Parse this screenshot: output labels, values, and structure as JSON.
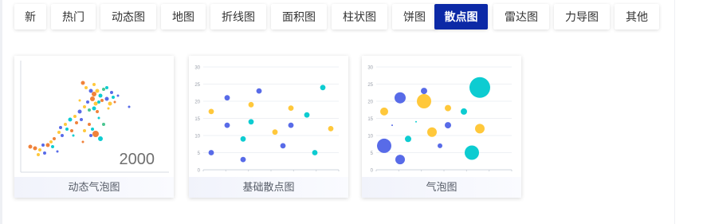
{
  "tabs": [
    {
      "label": "新",
      "active": false
    },
    {
      "label": "热门",
      "active": false
    },
    {
      "label": "动态图",
      "active": false
    },
    {
      "label": "地图",
      "active": false
    },
    {
      "label": "折线图",
      "active": false
    },
    {
      "label": "面积图",
      "active": false
    },
    {
      "label": "柱状图",
      "active": false
    },
    {
      "label": "饼图",
      "active": false
    },
    {
      "label": "散点图",
      "active": true
    },
    {
      "label": "雷达图",
      "active": false
    },
    {
      "label": "力导图",
      "active": false
    },
    {
      "label": "其他",
      "active": false
    }
  ],
  "cards": [
    {
      "caption": "动态气泡图",
      "year_label": "2000"
    },
    {
      "caption": "基础散点图"
    },
    {
      "caption": "气泡图"
    }
  ],
  "colors": {
    "active_tab": "#0c29a6",
    "blue": "#4f63e7",
    "yellow": "#ffc530",
    "cyan": "#00c9cf",
    "orange": "#ef7b2f",
    "green": "#3fc28a"
  },
  "chart_data": [
    {
      "type": "scatter",
      "title": "",
      "note": "dense animated bubble scatter thumbnail",
      "year_label": "2000"
    },
    {
      "type": "scatter",
      "title": "",
      "ylim": [
        0,
        30
      ],
      "ytick_labels": [
        "0",
        "5",
        "10",
        "15",
        "20",
        "25",
        "30"
      ],
      "series": [
        {
          "color": "#ffc530",
          "points": [
            [
              1,
              17
            ],
            [
              6,
              19
            ],
            [
              9,
              11
            ],
            [
              11,
              18
            ],
            [
              16,
              12
            ]
          ]
        },
        {
          "color": "#4f63e7",
          "points": [
            [
              1,
              5
            ],
            [
              3,
              21
            ],
            [
              3,
              13
            ],
            [
              5,
              3
            ],
            [
              7,
              23
            ],
            [
              10,
              7
            ],
            [
              11,
              13
            ]
          ]
        },
        {
          "color": "#00c9cf",
          "points": [
            [
              5,
              9
            ],
            [
              6,
              14
            ],
            [
              13,
              16
            ],
            [
              14,
              5
            ],
            [
              15,
              24
            ]
          ]
        }
      ]
    },
    {
      "type": "scatter",
      "title": "",
      "ylim": [
        0,
        30
      ],
      "ytick_labels": [
        "0",
        "5",
        "10",
        "15",
        "20",
        "25",
        "30"
      ],
      "series": [
        {
          "color": "#ffc530",
          "points": [
            [
              1,
              17,
              5
            ],
            [
              6,
              20,
              9
            ],
            [
              7,
              11,
              6
            ],
            [
              9,
              18,
              4
            ],
            [
              13,
              12,
              6
            ]
          ]
        },
        {
          "color": "#4f63e7",
          "points": [
            [
              1,
              7,
              9
            ],
            [
              3,
              3,
              6
            ],
            [
              3,
              21,
              7
            ],
            [
              6,
              23,
              4
            ],
            [
              8,
              7,
              3
            ],
            [
              9,
              13,
              4
            ],
            [
              2,
              13,
              1
            ]
          ]
        },
        {
          "color": "#00c9cf",
          "points": [
            [
              4,
              9,
              4
            ],
            [
              5,
              14,
              1
            ],
            [
              11,
              17,
              4
            ],
            [
              12,
              5,
              9
            ],
            [
              13,
              24,
              13
            ]
          ]
        }
      ]
    }
  ]
}
